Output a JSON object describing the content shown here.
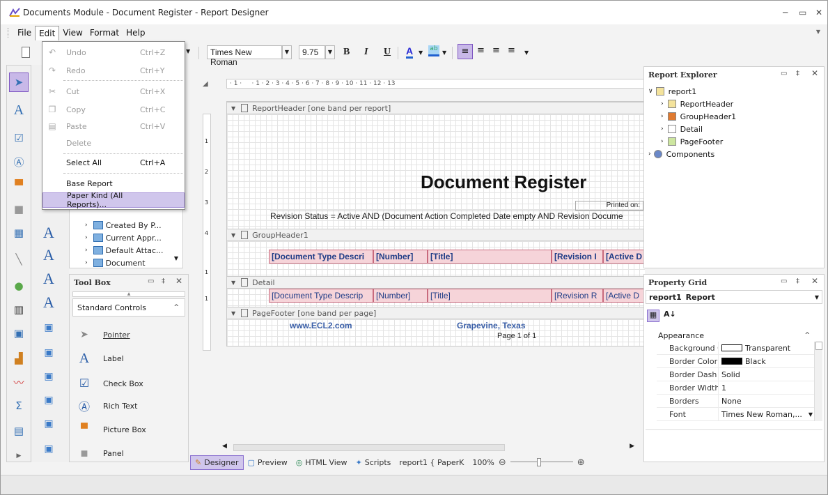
{
  "window": {
    "title": "Documents Module - Document Register - Report Designer",
    "controls": [
      "─",
      "▭",
      "✕"
    ]
  },
  "menubar": {
    "items": [
      "File",
      "Edit",
      "View",
      "Format",
      "Help"
    ],
    "active": "Edit"
  },
  "toolbar": {
    "font_name": "Times New Roman",
    "font_size": "9.75",
    "bold": "B",
    "italic": "I",
    "underline": "U"
  },
  "edit_menu": {
    "items": [
      {
        "label": "Undo",
        "shortcut": "Ctrl+Z",
        "enabled": false,
        "icon": "undo-icon"
      },
      {
        "label": "Redo",
        "shortcut": "Ctrl+Y",
        "enabled": false,
        "icon": "redo-icon"
      },
      {
        "label": "Cut",
        "shortcut": "Ctrl+X",
        "enabled": false,
        "icon": "cut-icon"
      },
      {
        "label": "Copy",
        "shortcut": "Ctrl+C",
        "enabled": false,
        "icon": "copy-icon"
      },
      {
        "label": "Paste",
        "shortcut": "Ctrl+V",
        "enabled": false,
        "icon": "paste-icon"
      },
      {
        "label": "Delete",
        "shortcut": "",
        "enabled": false,
        "icon": ""
      },
      {
        "label": "Select All",
        "shortcut": "Ctrl+A",
        "enabled": true,
        "icon": ""
      },
      {
        "label": "Base Report",
        "shortcut": "",
        "enabled": true,
        "icon": ""
      },
      {
        "label": "Paper Kind (All Reports)...",
        "shortcut": "",
        "enabled": true,
        "icon": ""
      }
    ]
  },
  "field_list": {
    "items": [
      "Created By P...",
      "Current Appr...",
      "Default Attac...",
      "Document"
    ]
  },
  "toolbox": {
    "title": "Tool Box",
    "group": "Standard Controls",
    "items": [
      "Pointer",
      "Label",
      "Check Box",
      "Rich Text",
      "Picture Box",
      "Panel"
    ]
  },
  "designer": {
    "ruler": "· 1 ·     · 1 · 2 · 3 · 4 · 5 · 6 · 7 · 8 · 9 · 10 · 11 · 12 · 13",
    "vruler_marks": [
      "1",
      "2",
      "3",
      "4",
      "1",
      "1"
    ],
    "bands": {
      "report_header": "ReportHeader [one band per report]",
      "group_header": "GroupHeader1",
      "detail": "Detail",
      "page_footer": "PageFooter [one band per page]"
    },
    "report_title": "Document Register",
    "printed_on": "Printed on:",
    "revision_status": "Revision Status = Active AND (Document Action Completed Date empty AND Revision Docume",
    "group_cells": [
      "[Document Type Descri",
      "[Number]",
      "[Title]",
      "[Revision I",
      "[Active D"
    ],
    "detail_cells": [
      "[Document Type Descrip",
      "[Number]",
      "[Title]",
      "[Revision R",
      "[Active D"
    ],
    "footer_left": "www.ECL2.com",
    "footer_center": "Grapevine, Texas",
    "footer_page": "Page 1 of 1"
  },
  "bottom_tabs": {
    "designer": "Designer",
    "preview": "Preview",
    "html_view": "HTML View",
    "scripts": "Scripts",
    "report_info": "report1 { PaperK",
    "zoom": "100%"
  },
  "report_explorer": {
    "title": "Report Explorer",
    "root": "report1",
    "children": [
      "ReportHeader",
      "GroupHeader1",
      "Detail",
      "PageFooter"
    ],
    "components": "Components"
  },
  "property_grid": {
    "title": "Property Grid",
    "selected": "report1",
    "selected_type": "Report",
    "category": "Appearance",
    "rows": [
      {
        "name": "Background Col",
        "value": "Transparent",
        "swatch": "#ffffff"
      },
      {
        "name": "Border Color",
        "value": "Black",
        "swatch": "#000000"
      },
      {
        "name": "Border Dash Sty",
        "value": "Solid",
        "swatch": ""
      },
      {
        "name": "Border Width",
        "value": "1",
        "swatch": ""
      },
      {
        "name": "Borders",
        "value": "None",
        "swatch": ""
      },
      {
        "name": "Font",
        "value": "Times New Roman,...",
        "swatch": ""
      }
    ]
  },
  "colors": {
    "accent": "#7e57c2",
    "highlight": "#d0c6ec",
    "band_cell": "#f6d4d9"
  }
}
